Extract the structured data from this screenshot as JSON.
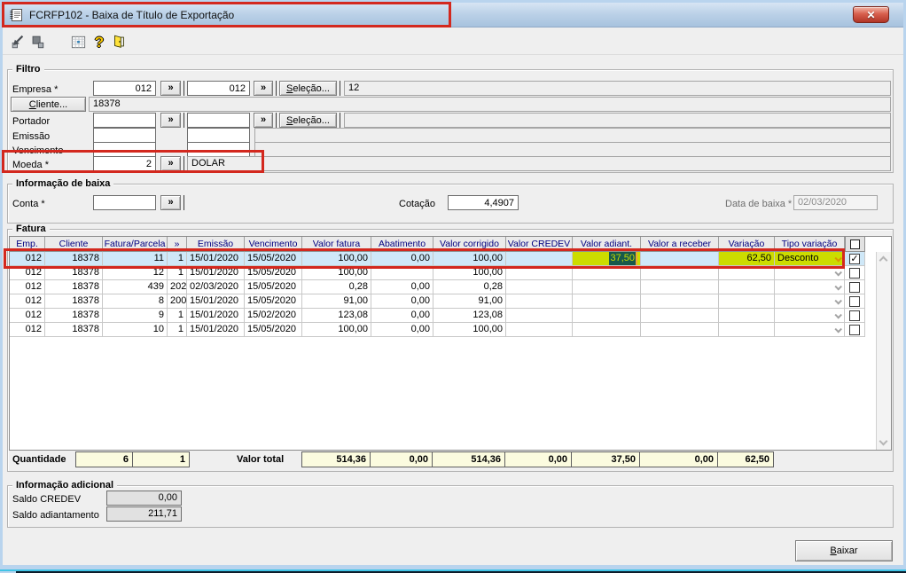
{
  "window": {
    "title": "FCRFP102 - Baixa de Título de Exportação"
  },
  "toolbar": {
    "icons": [
      "export-icon",
      "cascade-icon",
      "calendar-icon",
      "help-icon",
      "exit-door-icon"
    ]
  },
  "filtro": {
    "legend": "Filtro",
    "lookup": "»",
    "empresa": {
      "label": "Empresa *",
      "value1": "012",
      "value2": "012",
      "selecao": "Seleção...",
      "desc": "12"
    },
    "cliente": {
      "button": "Cliente...",
      "value": "18378"
    },
    "portador": {
      "label": "Portador",
      "value1": "",
      "value2": "",
      "selecao": "Seleção...",
      "desc": ""
    },
    "emissao": {
      "label": "Emissão",
      "value1": "",
      "value2": ""
    },
    "vencimento": {
      "label": "Vencimento",
      "value1": "",
      "value2": ""
    },
    "moeda": {
      "label": "Moeda *",
      "value": "2",
      "desc": "DOLAR"
    }
  },
  "baixa": {
    "legend": "Informação de baixa",
    "conta_label": "Conta *",
    "conta_value": "",
    "cotacao_label": "Cotação",
    "cotacao_value": "4,4907",
    "data_label": "Data de baixa *",
    "data_value": "02/03/2020"
  },
  "fatura": {
    "legend": "Fatura",
    "columns": [
      "Emp.",
      "Cliente",
      "Fatura/Parcela",
      "»",
      "Emissão",
      "Vencimento",
      "Valor fatura",
      "Abatimento",
      "Valor corrigido",
      "Valor CREDEV",
      "Valor adiant.",
      "Valor a receber",
      "Variação",
      "Tipo variação"
    ],
    "rows": [
      {
        "emp": "012",
        "cliente": "18378",
        "fatura": "11",
        "parcela": "1",
        "emissao": "15/01/2020",
        "vencimento": "15/05/2020",
        "valor_fatura": "100,00",
        "abatimento": "0,00",
        "valor_corrigido": "100,00",
        "valor_credev": "",
        "valor_adiant": "37,50",
        "valor_a_receber": "",
        "variacao": "62,50",
        "tipo_variacao": "Desconto",
        "checked": true,
        "selected": true
      },
      {
        "emp": "012",
        "cliente": "18378",
        "fatura": "12",
        "parcela": "1",
        "emissao": "15/01/2020",
        "vencimento": "15/05/2020",
        "valor_fatura": "100,00",
        "abatimento": "",
        "valor_corrigido": "100,00",
        "valor_credev": "",
        "valor_adiant": "",
        "valor_a_receber": "",
        "variacao": "",
        "tipo_variacao": "",
        "checked": false,
        "selected": false
      },
      {
        "emp": "012",
        "cliente": "18378",
        "fatura": "439",
        "parcela": "202",
        "emissao": "02/03/2020",
        "vencimento": "15/05/2020",
        "valor_fatura": "0,28",
        "abatimento": "0,00",
        "valor_corrigido": "0,28",
        "valor_credev": "",
        "valor_adiant": "",
        "valor_a_receber": "",
        "variacao": "",
        "tipo_variacao": "",
        "checked": false,
        "selected": false
      },
      {
        "emp": "012",
        "cliente": "18378",
        "fatura": "8",
        "parcela": "200",
        "emissao": "15/01/2020",
        "vencimento": "15/05/2020",
        "valor_fatura": "91,00",
        "abatimento": "0,00",
        "valor_corrigido": "91,00",
        "valor_credev": "",
        "valor_adiant": "",
        "valor_a_receber": "",
        "variacao": "",
        "tipo_variacao": "",
        "checked": false,
        "selected": false
      },
      {
        "emp": "012",
        "cliente": "18378",
        "fatura": "9",
        "parcela": "1",
        "emissao": "15/01/2020",
        "vencimento": "15/02/2020",
        "valor_fatura": "123,08",
        "abatimento": "0,00",
        "valor_corrigido": "123,08",
        "valor_credev": "",
        "valor_adiant": "",
        "valor_a_receber": "",
        "variacao": "",
        "tipo_variacao": "",
        "checked": false,
        "selected": false
      },
      {
        "emp": "012",
        "cliente": "18378",
        "fatura": "10",
        "parcela": "1",
        "emissao": "15/01/2020",
        "vencimento": "15/05/2020",
        "valor_fatura": "100,00",
        "abatimento": "0,00",
        "valor_corrigido": "100,00",
        "valor_credev": "",
        "valor_adiant": "",
        "valor_a_receber": "",
        "variacao": "",
        "tipo_variacao": "",
        "checked": false,
        "selected": false
      }
    ],
    "totais": {
      "quantidade_label": "Quantidade",
      "quantidade_1": "6",
      "quantidade_2": "1",
      "valor_total_label": "Valor total",
      "valor_fatura": "514,36",
      "abatimento": "0,00",
      "valor_corrigido": "514,36",
      "valor_credev": "0,00",
      "valor_adiant": "37,50",
      "valor_a_receber": "0,00",
      "variacao": "62,50"
    }
  },
  "adicional": {
    "legend": "Informação adicional",
    "saldo_credev_label": "Saldo CREDEV",
    "saldo_credev": "0,00",
    "saldo_adiantamento_label": "Saldo adiantamento",
    "saldo_adiantamento": "211,71"
  },
  "footer": {
    "baixar": "Baixar"
  },
  "colors": {
    "highlight_green": "#ccdc00",
    "selection_blue": "#cfe8f8",
    "annotation_red": "#d3281e",
    "header_text": "#000080",
    "total_bg": "#fbfbdf"
  }
}
